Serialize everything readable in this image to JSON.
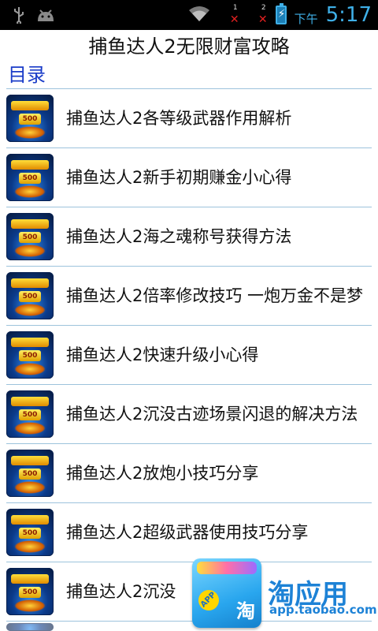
{
  "status_bar": {
    "left_icons": [
      "usb-icon",
      "android-debug-icon"
    ],
    "sim1_label": "1",
    "sim2_label": "2",
    "ampm": "下午",
    "time": "5:17",
    "accent_color": "#3fb0e8"
  },
  "header": {
    "title": "捕鱼达人2无限财富攻略",
    "section_label": "目录",
    "section_color": "#1a3cc8"
  },
  "list": {
    "items": [
      {
        "label": "捕鱼达人2各等级武器作用解析"
      },
      {
        "label": "捕鱼达人2新手初期赚金小心得"
      },
      {
        "label": "捕鱼达人2海之魂称号获得方法"
      },
      {
        "label": "捕鱼达人2倍率修改技巧 一炮万金不是梦"
      },
      {
        "label": "捕鱼达人2快速升级小心得"
      },
      {
        "label": "捕鱼达人2沉没古迹场景闪退的解决方法"
      },
      {
        "label": "捕鱼达人2放炮小技巧分享"
      },
      {
        "label": "捕鱼达人2超级武器使用技巧分享"
      },
      {
        "label": "捕鱼达人2沉没"
      }
    ],
    "thumb_badge": "500"
  },
  "watermark": {
    "brand": "淘应用",
    "url": "app.taobao.com",
    "badge_app": "APP",
    "badge_tao": "淘"
  }
}
